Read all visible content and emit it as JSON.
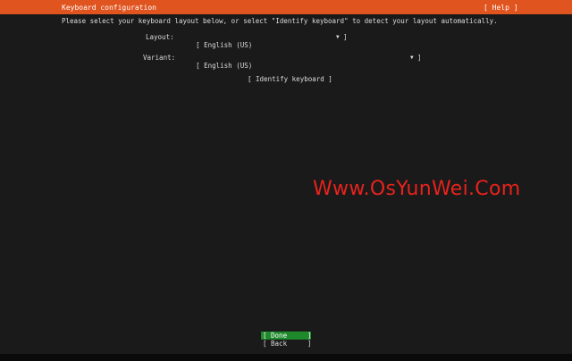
{
  "header": {
    "title": "Keyboard configuration",
    "help_label": "[ Help ]"
  },
  "main": {
    "instructions": "Please select your keyboard layout below, or select \"Identify keyboard\" to detect your layout automatically.",
    "layout": {
      "label": "Layout:",
      "value": "[ English (US)",
      "arrow": "▼",
      "close_bracket": "]"
    },
    "variant": {
      "label": "Variant:",
      "value": "[ English (US)",
      "arrow": "▼",
      "close_bracket": "]"
    },
    "identify_button": "[ Identify keyboard ]"
  },
  "watermark": "Www.OsYunWei.Com",
  "footer": {
    "done_label": "[ Done",
    "back_label": "[ Back",
    "close_bracket": "]"
  },
  "colors": {
    "header_bg": "#e0541f",
    "background": "#1a1a1a",
    "done_bg": "#1f8a2c",
    "watermark": "#e8221c"
  }
}
